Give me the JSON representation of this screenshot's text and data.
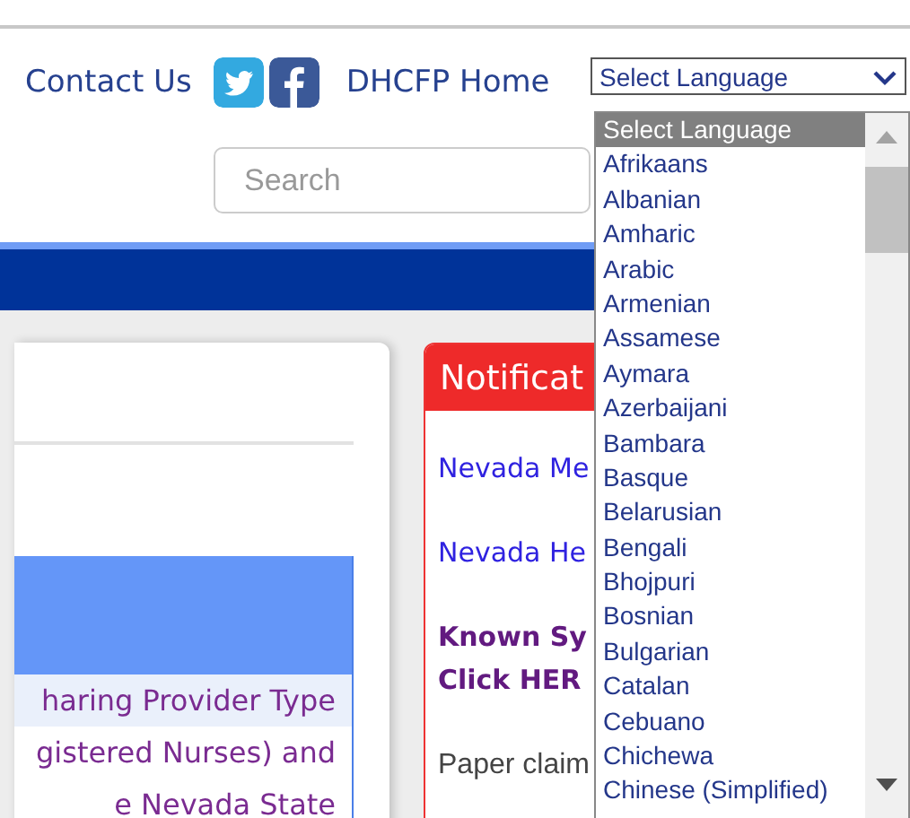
{
  "header": {
    "links": [
      {
        "kind": "text",
        "label": "Contact Us"
      },
      {
        "kind": "twitter"
      },
      {
        "kind": "facebook"
      },
      {
        "kind": "text",
        "label": "DHCFP Home"
      }
    ]
  },
  "language_select": {
    "value": "Select Language",
    "options": [
      {
        "label": "Select Language",
        "selected": true
      },
      {
        "label": "Afrikaans",
        "selected": false
      },
      {
        "label": "Albanian",
        "selected": false
      },
      {
        "label": "Amharic",
        "selected": false
      },
      {
        "label": "Arabic",
        "selected": false
      },
      {
        "label": "Armenian",
        "selected": false
      },
      {
        "label": "Assamese",
        "selected": false
      },
      {
        "label": "Aymara",
        "selected": false
      },
      {
        "label": "Azerbaijani",
        "selected": false
      },
      {
        "label": "Bambara",
        "selected": false
      },
      {
        "label": "Basque",
        "selected": false
      },
      {
        "label": "Belarusian",
        "selected": false
      },
      {
        "label": "Bengali",
        "selected": false
      },
      {
        "label": "Bhojpuri",
        "selected": false
      },
      {
        "label": "Bosnian",
        "selected": false
      },
      {
        "label": "Bulgarian",
        "selected": false
      },
      {
        "label": "Catalan",
        "selected": false
      },
      {
        "label": "Cebuano",
        "selected": false
      },
      {
        "label": "Chichewa",
        "selected": false
      },
      {
        "label": "Chinese (Simplified)",
        "selected": false
      }
    ]
  },
  "search": {
    "placeholder": "Search"
  },
  "left_panel": {
    "rows": [
      {
        "text": "haring Provider Type",
        "shaded": true
      },
      {
        "text": "gistered Nurses) and",
        "shaded": false
      },
      {
        "text": "e Nevada State",
        "shaded": false
      }
    ]
  },
  "notifications": {
    "title": "Notificat",
    "items": [
      {
        "kind": "link",
        "text": "Nevada Me"
      },
      {
        "kind": "link",
        "text": "Nevada He"
      },
      {
        "kind": "bold",
        "text": "Known Sy"
      },
      {
        "kind": "bold",
        "text": "Click HER"
      },
      {
        "kind": "plain",
        "text": "Paper claim"
      }
    ]
  }
}
